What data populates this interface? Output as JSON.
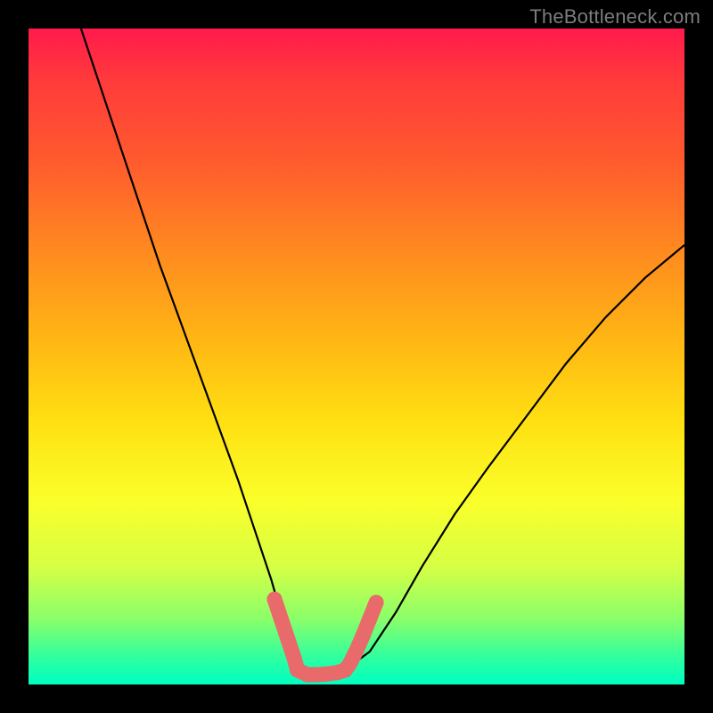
{
  "watermark": "TheBottleneck.com",
  "colors": {
    "frame": "#000000",
    "curve_stroke": "#000000",
    "marker_fill": "#e96a6a",
    "marker_stroke": "#c95454"
  },
  "chart_data": {
    "type": "line",
    "title": "",
    "xlabel": "",
    "ylabel": "",
    "xlim": [
      0,
      100
    ],
    "ylim": [
      0,
      100
    ],
    "grid": false,
    "legend": false,
    "series": [
      {
        "name": "bottleneck-curve",
        "x": [
          8,
          12,
          16,
          20,
          24,
          28,
          32,
          35,
          37,
          39,
          40,
          41,
          42,
          43,
          44,
          45,
          47,
          49,
          52,
          56,
          60,
          65,
          70,
          76,
          82,
          88,
          94,
          100
        ],
        "y": [
          100,
          88,
          76,
          64,
          53,
          42,
          31,
          22,
          16,
          9,
          5,
          2,
          1.5,
          1.5,
          1.5,
          1.8,
          2,
          2.8,
          5,
          11,
          18,
          26,
          33,
          41,
          49,
          56,
          62,
          67
        ]
      }
    ],
    "markers": {
      "name": "highlight-region",
      "points": [
        {
          "x": 37.5,
          "y": 13
        },
        {
          "x": 38.5,
          "y": 10
        },
        {
          "x": 39.5,
          "y": 7
        },
        {
          "x": 40.5,
          "y": 4
        },
        {
          "x": 41.0,
          "y": 2.2
        },
        {
          "x": 42.5,
          "y": 1.5
        },
        {
          "x": 44.0,
          "y": 1.5
        },
        {
          "x": 45.5,
          "y": 1.6
        },
        {
          "x": 47.0,
          "y": 1.8
        },
        {
          "x": 48.3,
          "y": 2.2
        },
        {
          "x": 49.0,
          "y": 3.2
        },
        {
          "x": 50.0,
          "y": 5.2
        },
        {
          "x": 51.0,
          "y": 7.5
        },
        {
          "x": 52.0,
          "y": 10
        },
        {
          "x": 53.0,
          "y": 12.5
        }
      ]
    }
  }
}
